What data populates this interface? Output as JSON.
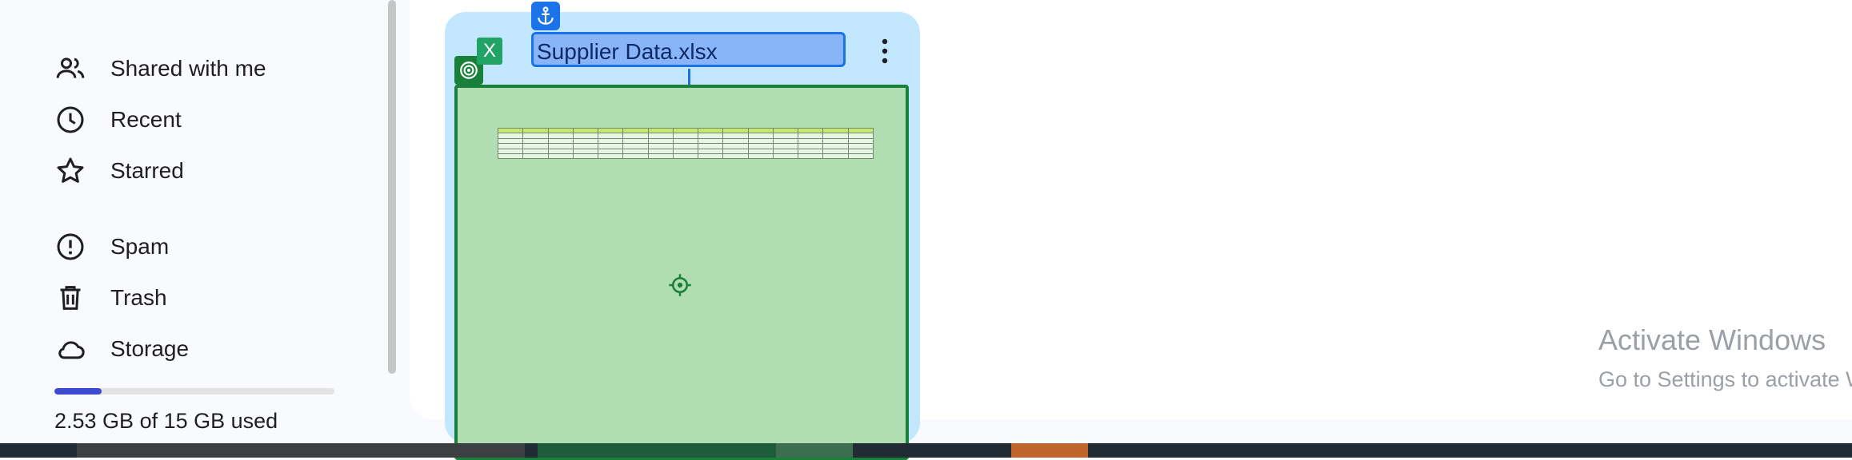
{
  "sidebar": {
    "items": [
      {
        "label": "Shared with me",
        "icon": "people-icon"
      },
      {
        "label": "Recent",
        "icon": "clock-icon"
      },
      {
        "label": "Starred",
        "icon": "star-icon"
      },
      {
        "label": "Spam",
        "icon": "spam-icon"
      },
      {
        "label": "Trash",
        "icon": "trash-icon"
      },
      {
        "label": "Storage",
        "icon": "cloud-icon"
      }
    ],
    "storage": {
      "used_text": "2.53 GB of 15 GB used",
      "used_fraction": 0.169
    }
  },
  "file_card": {
    "title": "Supplier Data.xlsx",
    "badge": "X",
    "brand_color": "#21a366"
  },
  "watermark": {
    "line1": "Activate Windows",
    "line2": "Go to Settings to activate Windows."
  }
}
